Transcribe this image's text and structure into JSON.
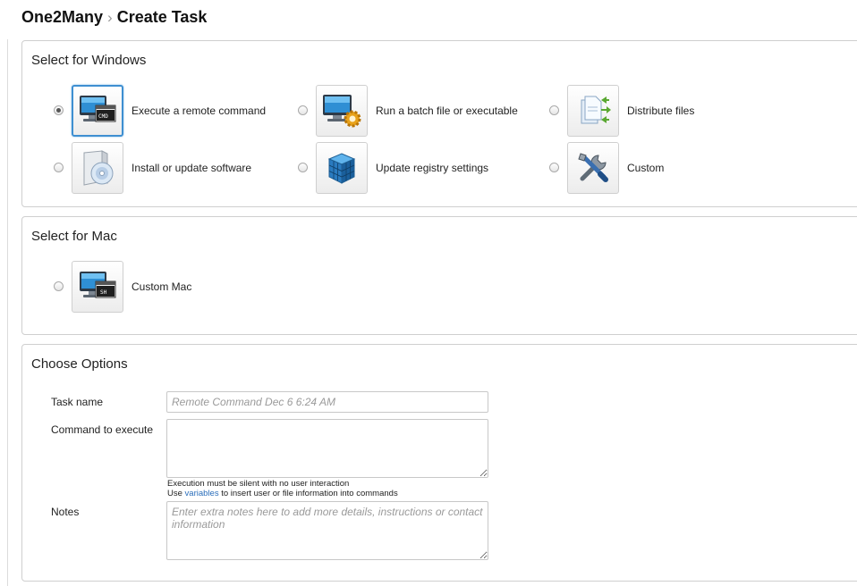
{
  "breadcrumb": {
    "app": "One2Many",
    "separator": "›",
    "page": "Create Task"
  },
  "windows": {
    "title": "Select for Windows",
    "options": [
      {
        "label": "Execute a remote command",
        "icon": "monitor-cmd-icon",
        "checked": true
      },
      {
        "label": "Run a batch file or executable",
        "icon": "monitor-gear-icon",
        "checked": false
      },
      {
        "label": "Distribute files",
        "icon": "distribute-files-icon",
        "checked": false
      },
      {
        "label": "Install or update software",
        "icon": "software-box-icon",
        "checked": false
      },
      {
        "label": "Update registry settings",
        "icon": "registry-cube-icon",
        "checked": false
      },
      {
        "label": "Custom",
        "icon": "tools-icon",
        "checked": false
      }
    ]
  },
  "mac": {
    "title": "Select for Mac",
    "options": [
      {
        "label": "Custom Mac",
        "icon": "monitor-sh-icon",
        "checked": false
      }
    ]
  },
  "options": {
    "title": "Choose Options",
    "task_name_label": "Task name",
    "task_name_placeholder": "Remote Command Dec 6 6:24 AM",
    "command_label": "Command to execute",
    "command_value": "",
    "hint_line1": "Execution must be silent with no user interaction",
    "hint_use": "Use",
    "hint_link": "variables",
    "hint_rest": "to insert user or file information into commands",
    "notes_label": "Notes",
    "notes_placeholder": "Enter extra notes here to add more details, instructions or contact information"
  }
}
